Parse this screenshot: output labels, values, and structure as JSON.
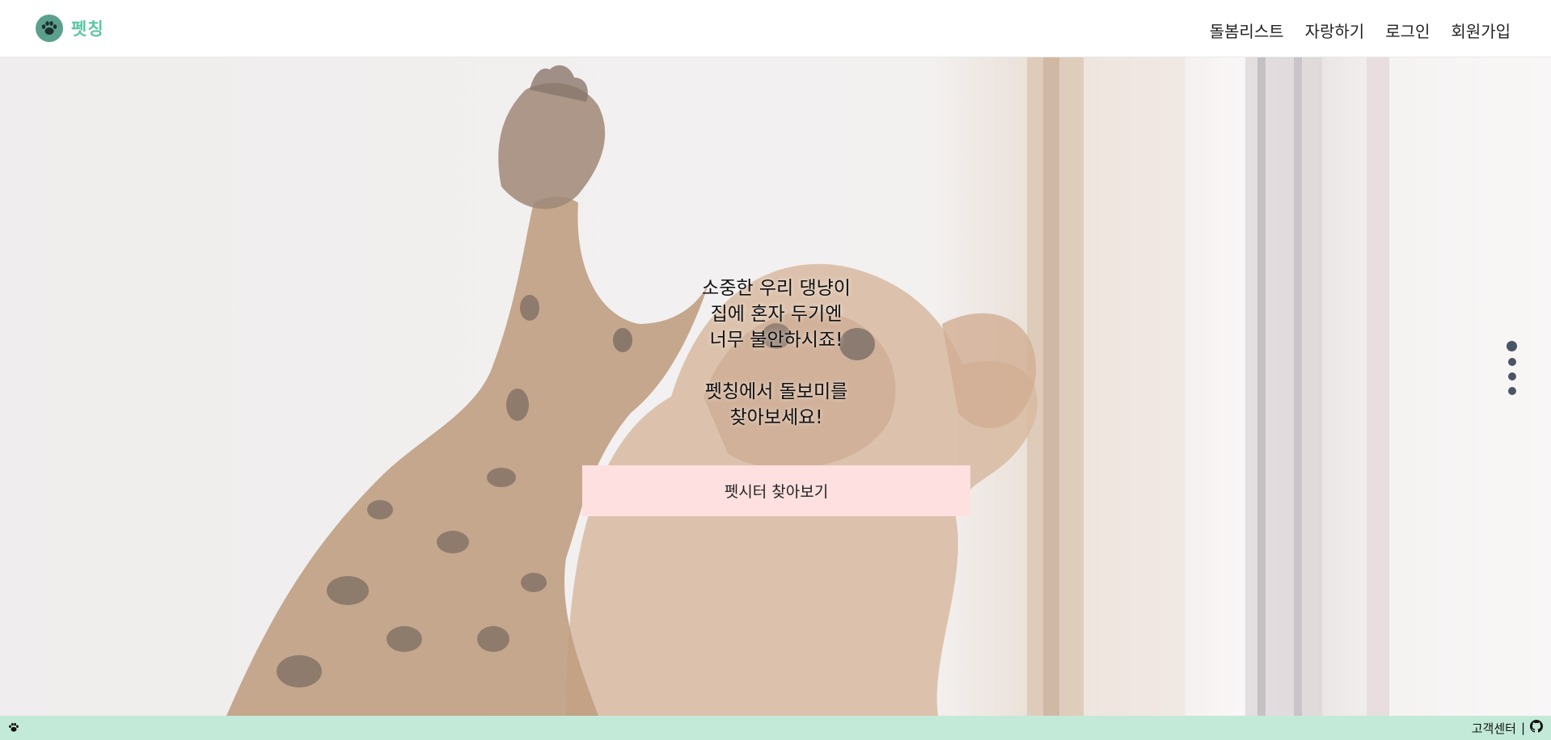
{
  "brand": {
    "name": "펫칭",
    "logo_icon": "paw-icon",
    "accent_color": "#5cc6a4"
  },
  "nav": {
    "items": [
      {
        "label": "돌봄리스트"
      },
      {
        "label": "자랑하기"
      },
      {
        "label": "로그인"
      },
      {
        "label": "회원가입"
      }
    ]
  },
  "hero": {
    "lines_1": [
      "소중한 우리 댕냥이",
      "집에 혼자 두기엔",
      "너무 불안하시죠!"
    ],
    "lines_2": [
      "펫칭에서 돌보미를",
      "찾아보세요!"
    ],
    "cta_label": "펫시터 찾아보기",
    "cta_color": "#ffe0e0"
  },
  "pager": {
    "total": 4,
    "active_index": 0
  },
  "footer": {
    "left_icon": "paw-icon",
    "support_label": "고객센터",
    "separator": "|",
    "github_icon": "github-icon",
    "background": "#c3ead9"
  }
}
